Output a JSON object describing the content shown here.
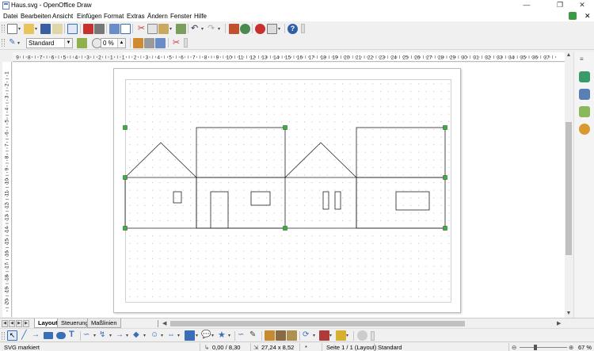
{
  "window": {
    "title": "Haus.svg - OpenOffice Draw",
    "controls": [
      "minimize",
      "maximize",
      "close"
    ]
  },
  "menu": [
    {
      "label": "Datei"
    },
    {
      "label": "Bearbeiten"
    },
    {
      "label": "Ansicht"
    },
    {
      "label": "Einfügen"
    },
    {
      "label": "Format"
    },
    {
      "label": "Extras"
    },
    {
      "label": "Ändern"
    },
    {
      "label": "Fenster"
    },
    {
      "label": "Hilfe"
    }
  ],
  "toolbar_standard": {
    "icons": [
      "new-icon",
      "open-icon",
      "save-icon",
      "mail-icon",
      "edit-file-icon",
      "export-pdf-icon",
      "print-icon",
      "print-direct-icon",
      "spellcheck-icon",
      "autospell-icon",
      "cut-icon",
      "copy-icon",
      "paste-icon",
      "format-paintbrush-icon",
      "undo-icon",
      "redo-icon",
      "show-draw-functions-icon",
      "chart-icon",
      "navigator-icon",
      "zoom-icon",
      "help-icon"
    ]
  },
  "toolbar_line_fill": {
    "style_value": "Standard",
    "transparency_value": "0 %",
    "icons": [
      "styles-icon",
      "line-color-icon",
      "fill-color-icon",
      "shadow-icon",
      "area-icon",
      "bullets-icon"
    ]
  },
  "ruler": {
    "h_labels": [
      "9",
      "8",
      "7",
      "6",
      "5",
      "4",
      "3",
      "2",
      "1",
      "1",
      "2",
      "3",
      "4",
      "5",
      "6",
      "7",
      "8",
      "9",
      "10",
      "11",
      "12",
      "13",
      "14",
      "15",
      "16",
      "17",
      "18",
      "19",
      "20",
      "21",
      "22",
      "23",
      "24",
      "25",
      "26",
      "27",
      "28",
      "29",
      "30",
      "31",
      "32",
      "33",
      "34",
      "35",
      "36",
      "37"
    ],
    "v_labels": [
      "1",
      "2",
      "3",
      "4",
      "5",
      "6",
      "7",
      "8",
      "9",
      "10",
      "11",
      "12",
      "13",
      "14",
      "15",
      "16",
      "17",
      "18",
      "19",
      "20"
    ]
  },
  "sheet_tabs": {
    "tabs": [
      "Layout",
      "Steuerung",
      "Maßlinien"
    ],
    "active": "Layout"
  },
  "drawing_toolbar": {
    "icons": [
      "select-icon",
      "line-icon",
      "arrow-line-icon",
      "rectangle-icon",
      "ellipse-icon",
      "text-icon",
      "curve-icon",
      "connector-icon",
      "lines-arrows-icon",
      "basic-shapes-icon",
      "symbol-shapes-icon",
      "block-arrows-icon",
      "flowchart-icon",
      "callouts-icon",
      "stars-icon",
      "points-icon",
      "glue-points-icon",
      "fontwork-icon",
      "from-file-icon",
      "gallery-icon",
      "extrusion-icon",
      "rotate-icon",
      "alignment-icon",
      "arrange-icon",
      "extrusion-toggle-icon"
    ]
  },
  "status": {
    "selection": "SVG markiert",
    "position": "0,00 / 8,30",
    "size": "27,24 x 8,52",
    "modified": "*",
    "page": "Seite 1 / 1 (Layout)",
    "style": "Standard",
    "zoom": "67 %",
    "zoom_level": 0.67
  },
  "colors": {
    "handle": "#44aa44",
    "accent_blue": "#3a6fb8",
    "drawing_line": "#222222"
  }
}
